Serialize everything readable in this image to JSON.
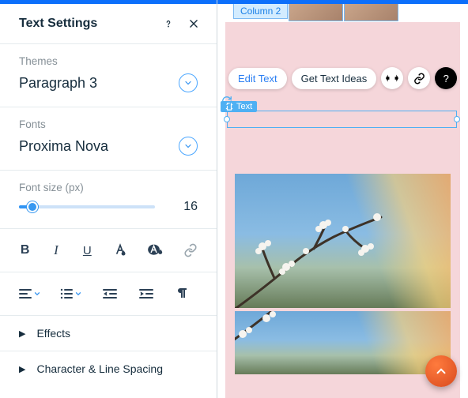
{
  "panel": {
    "title": "Text Settings",
    "themes": {
      "label": "Themes",
      "value": "Paragraph 3"
    },
    "fonts": {
      "label": "Fonts",
      "value": "Proxima Nova"
    },
    "fontsize": {
      "label": "Font size (px)",
      "value": "16"
    },
    "format": {
      "bold": "B",
      "italic": "I",
      "underline": "U"
    },
    "accordion": {
      "effects": "Effects",
      "spacing": "Character & Line Spacing"
    }
  },
  "canvas": {
    "tab": "Column 2",
    "toolbar": {
      "edit": "Edit Text",
      "ideas": "Get Text Ideas",
      "help": "?"
    },
    "badge": "Text"
  }
}
